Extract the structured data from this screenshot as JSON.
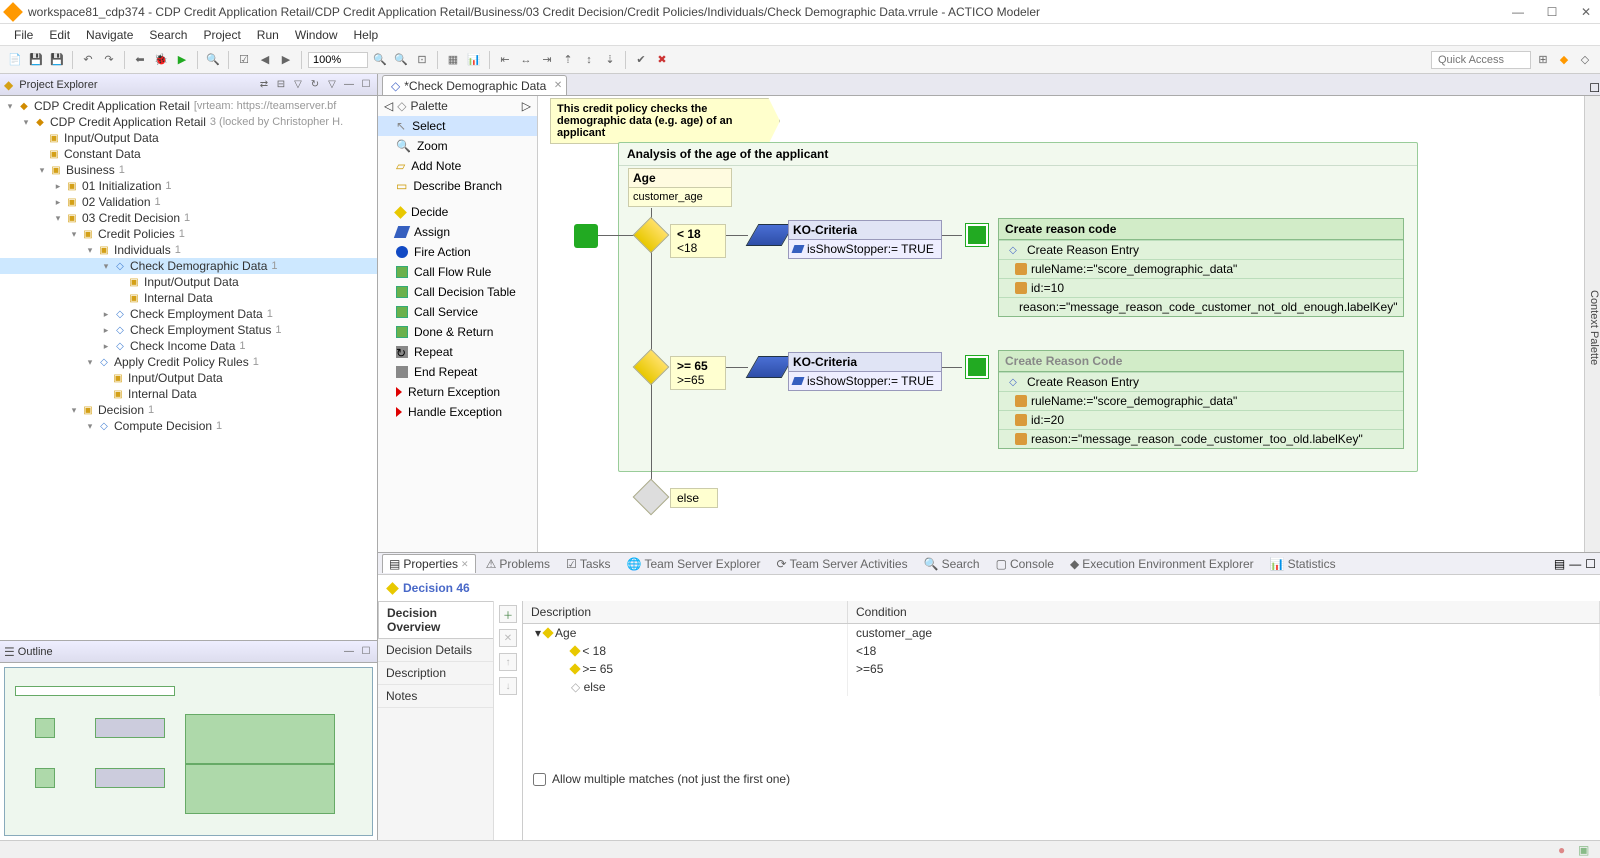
{
  "titlebar": {
    "title": "workspace81_cdp374 - CDP Credit Application Retail/CDP Credit Application Retail/Business/03 Credit Decision/Credit Policies/Individuals/Check Demographic Data.vrrule - ACTICO Modeler"
  },
  "menubar": [
    "File",
    "Edit",
    "Navigate",
    "Search",
    "Project",
    "Run",
    "Window",
    "Help"
  ],
  "toolbar": {
    "zoom": "100%",
    "quick_access": "Quick Access"
  },
  "explorer": {
    "title": "Project Explorer",
    "tree": {
      "root": {
        "label": "CDP Credit Application Retail",
        "extra": "[vrteam: https://teamserver.bf"
      },
      "module": {
        "label": "CDP Credit Application Retail",
        "extra": "3 (locked by Christopher H."
      },
      "io_data": "Input/Output Data",
      "constant": "Constant Data",
      "business": {
        "label": "Business",
        "extra": "1"
      },
      "init": {
        "label": "01 Initialization",
        "extra": "1"
      },
      "validation": {
        "label": "02 Validation",
        "extra": "1"
      },
      "credit_dec": {
        "label": "03 Credit Decision",
        "extra": "1"
      },
      "credit_pol": {
        "label": "Credit Policies",
        "extra": "1"
      },
      "individuals": {
        "label": "Individuals",
        "extra": "1"
      },
      "check_demo": {
        "label": "Check Demographic Data",
        "extra": "1"
      },
      "cd_io": "Input/Output Data",
      "cd_internal": "Internal Data",
      "check_emp": {
        "label": "Check Employment Data",
        "extra": "1"
      },
      "check_emp_status": {
        "label": "Check Employment Status",
        "extra": "1"
      },
      "check_income": {
        "label": "Check Income Data",
        "extra": "1"
      },
      "apply_rules": {
        "label": "Apply Credit Policy Rules",
        "extra": "1"
      },
      "ar_io": "Input/Output Data",
      "ar_internal": "Internal Data",
      "decision": {
        "label": "Decision",
        "extra": "1"
      },
      "compute": {
        "label": "Compute Decision",
        "extra": "1"
      }
    }
  },
  "outline": {
    "title": "Outline"
  },
  "editor": {
    "tab": "*Check Demographic Data",
    "palette_header": "Palette",
    "palette_items": [
      "Select",
      "Zoom",
      "Add Note",
      "Describe Branch",
      "Decide",
      "Assign",
      "Fire Action",
      "Call Flow Rule",
      "Call Decision Table",
      "Call Service",
      "Done & Return",
      "Repeat",
      "End Repeat",
      "Return Exception",
      "Handle Exception"
    ],
    "note": "This credit policy checks the demographic data (e.g. age) of an applicant",
    "analysis_title": "Analysis of the age of the applicant",
    "age": {
      "header": "Age",
      "body": "customer_age"
    },
    "cond1": {
      "h": "< 18",
      "b": "<18"
    },
    "cond2": {
      "h": ">= 65",
      "b": ">=65"
    },
    "cond3": "else",
    "ko1": {
      "h": "KO-Criteria",
      "b": "isShowStopper:= TRUE"
    },
    "ko2": {
      "h": "KO-Criteria",
      "b": "isShowStopper:= TRUE"
    },
    "reason1": {
      "h": "Create reason code",
      "sub": "Create Reason Entry",
      "r1": "ruleName:=\"score_demographic_data\"",
      "r2": "id:=10",
      "r3": "reason:=\"message_reason_code_customer_not_old_enough.labelKey\""
    },
    "reason2": {
      "h": "Create Reason Code",
      "sub": "Create Reason Entry",
      "r1": "ruleName:=\"score_demographic_data\"",
      "r2": "id:=20",
      "r3": "reason:=\"message_reason_code_customer_too_old.labelKey\""
    },
    "ctx_palette": "Context Palette"
  },
  "properties": {
    "tabs": [
      "Properties",
      "Problems",
      "Tasks",
      "Team Server Explorer",
      "Team Server Activities",
      "Search",
      "Console",
      "Execution Environment Explorer",
      "Statistics"
    ],
    "title": "Decision 46",
    "side_tabs": [
      "Decision Overview",
      "Decision Details",
      "Description",
      "Notes"
    ],
    "table": {
      "h_desc": "Description",
      "h_cond": "Condition",
      "rows": [
        {
          "desc": "Age",
          "cond": "customer_age",
          "depth": 0,
          "icon": "diamond-yellow",
          "twisty": "▾"
        },
        {
          "desc": "< 18",
          "cond": "<18",
          "depth": 1,
          "icon": "diamond-yellow"
        },
        {
          "desc": ">= 65",
          "cond": ">=65",
          "depth": 1,
          "icon": "diamond-yellow"
        },
        {
          "desc": "else",
          "cond": "",
          "depth": 1,
          "icon": "diamond-grey"
        }
      ]
    },
    "allow_multi": "Allow multiple matches (not just the first one)"
  }
}
